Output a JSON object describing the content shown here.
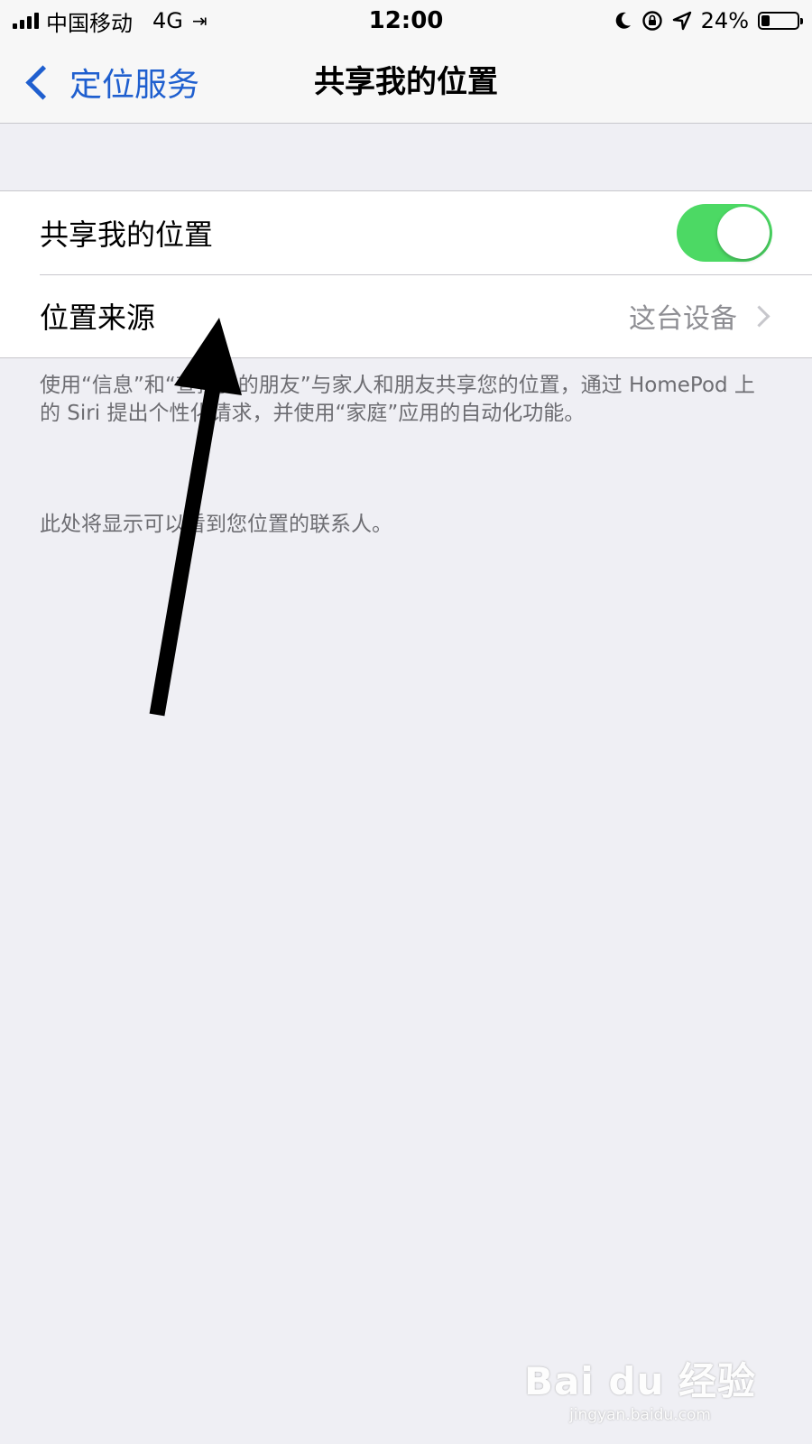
{
  "status_bar": {
    "carrier": "中国移动",
    "network": "4G",
    "call_icon": "call-forward-icon",
    "time": "12:00",
    "battery_text": "24%",
    "battery_level": 0.24,
    "icons": [
      "signal-icon",
      "moon-icon",
      "rotation-lock-icon",
      "location-arrow-icon",
      "battery-icon"
    ]
  },
  "nav": {
    "back_label": "定位服务",
    "title": "共享我的位置"
  },
  "settings": {
    "share_location": {
      "label": "共享我的位置",
      "enabled": true,
      "toggle_color": "#4cd964"
    },
    "location_source": {
      "label": "位置来源",
      "value": "这台设备"
    }
  },
  "footer": {
    "description": "使用“信息”和“查找我的朋友”与家人和朋友共享您的位置，通过 HomePod 上的 Siri 提出个性化请求，并使用“家庭”应用的自动化功能。",
    "contacts_note": "此处将显示可以看到您位置的联系人。"
  },
  "watermark": {
    "logo": "Bai du 经验",
    "url": "jingyan.baidu.com"
  },
  "colors": {
    "accent": "#1f5fcf",
    "background": "#efeff4",
    "toggle_on": "#4cd964"
  }
}
